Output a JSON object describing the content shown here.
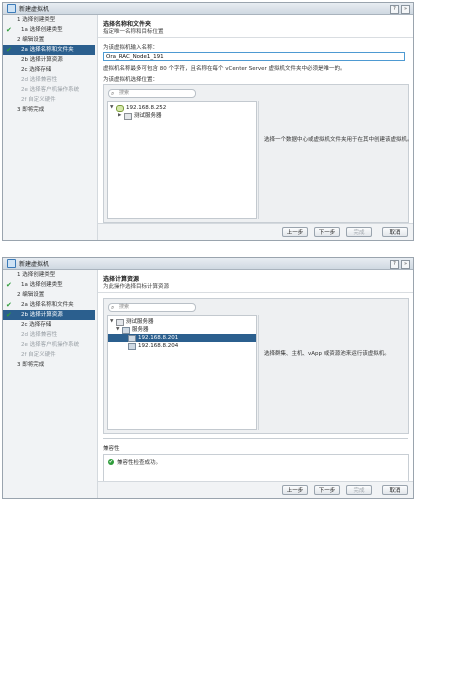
{
  "dialog1": {
    "title": "新建虚拟机",
    "steps": [
      {
        "label": "1 选择创建类型",
        "done": false,
        "state": "normal"
      },
      {
        "label": "1a 选择创建类型",
        "done": true,
        "state": "normal"
      },
      {
        "label": "2 编辑设置",
        "done": false,
        "state": "normal"
      },
      {
        "label": "2a 选择名称和文件夹",
        "done": true,
        "state": "active"
      },
      {
        "label": "2b 选择计算资源",
        "done": false,
        "state": "normal"
      },
      {
        "label": "2c 选择存储",
        "done": false,
        "state": "normal"
      },
      {
        "label": "2d 选择兼容性",
        "done": false,
        "state": "dim"
      },
      {
        "label": "2e 选择客户机操作系统",
        "done": false,
        "state": "dim"
      },
      {
        "label": "2f 自定义硬件",
        "done": false,
        "state": "dim"
      },
      {
        "label": "3 即将完成",
        "done": false,
        "state": "normal"
      }
    ],
    "page_title": "选择名称和文件夹",
    "page_subtitle": "指定唯一名称和目标位置",
    "name_label": "为该虚拟机输入名称：",
    "name_value": "Ora_RAC_Node1_191",
    "name_note": "虚拟机名称最多可包含 80 个字符，且名称在每个 vCenter Server 虚拟机文件夹中必须是唯一的。",
    "location_label": "为该虚拟机选择位置：",
    "search_placeholder": "搜索",
    "tree": [
      {
        "label": "192.168.8.252",
        "twisty": "▼",
        "icon": "datacenter"
      },
      {
        "label": "测试服务器",
        "twisty": "▶",
        "icon": "folder"
      }
    ],
    "hint": "选择一个数据中心或虚拟机文件夹用于在其中创建该虚拟机。",
    "buttons": {
      "back": "上一步",
      "next": "下一步",
      "finish": "完成",
      "cancel": "取消"
    }
  },
  "dialog2": {
    "title": "新建虚拟机",
    "steps": [
      {
        "label": "1 选择创建类型",
        "done": false,
        "state": "normal"
      },
      {
        "label": "1a 选择创建类型",
        "done": true,
        "state": "normal"
      },
      {
        "label": "2 编辑设置",
        "done": false,
        "state": "normal"
      },
      {
        "label": "2a 选择名称和文件夹",
        "done": true,
        "state": "normal"
      },
      {
        "label": "2b 选择计算资源",
        "done": true,
        "state": "active"
      },
      {
        "label": "2c 选择存储",
        "done": false,
        "state": "normal"
      },
      {
        "label": "2d 选择兼容性",
        "done": false,
        "state": "dim"
      },
      {
        "label": "2e 选择客户机操作系统",
        "done": false,
        "state": "dim"
      },
      {
        "label": "2f 自定义硬件",
        "done": false,
        "state": "dim"
      },
      {
        "label": "3 即将完成",
        "done": false,
        "state": "normal"
      }
    ],
    "page_title": "选择计算资源",
    "page_subtitle": "为此操作选择目标计算资源",
    "search_placeholder": "搜索",
    "tree": [
      {
        "label": "测试服务器",
        "twisty": "▼",
        "icon": "folder",
        "selected": false
      },
      {
        "label": "服务器",
        "twisty": "▼",
        "icon": "cluster",
        "selected": false
      },
      {
        "label": "192.168.8.201",
        "twisty": "",
        "icon": "host",
        "selected": true
      },
      {
        "label": "192.168.8.204",
        "twisty": "",
        "icon": "host",
        "selected": false
      }
    ],
    "hint": "选择群集、主机、vApp 或资源池来运行该虚拟机。",
    "compat_label": "兼容性",
    "compat_status": "兼容性检查成功。",
    "buttons": {
      "back": "上一步",
      "next": "下一步",
      "finish": "完成",
      "cancel": "取消"
    }
  }
}
